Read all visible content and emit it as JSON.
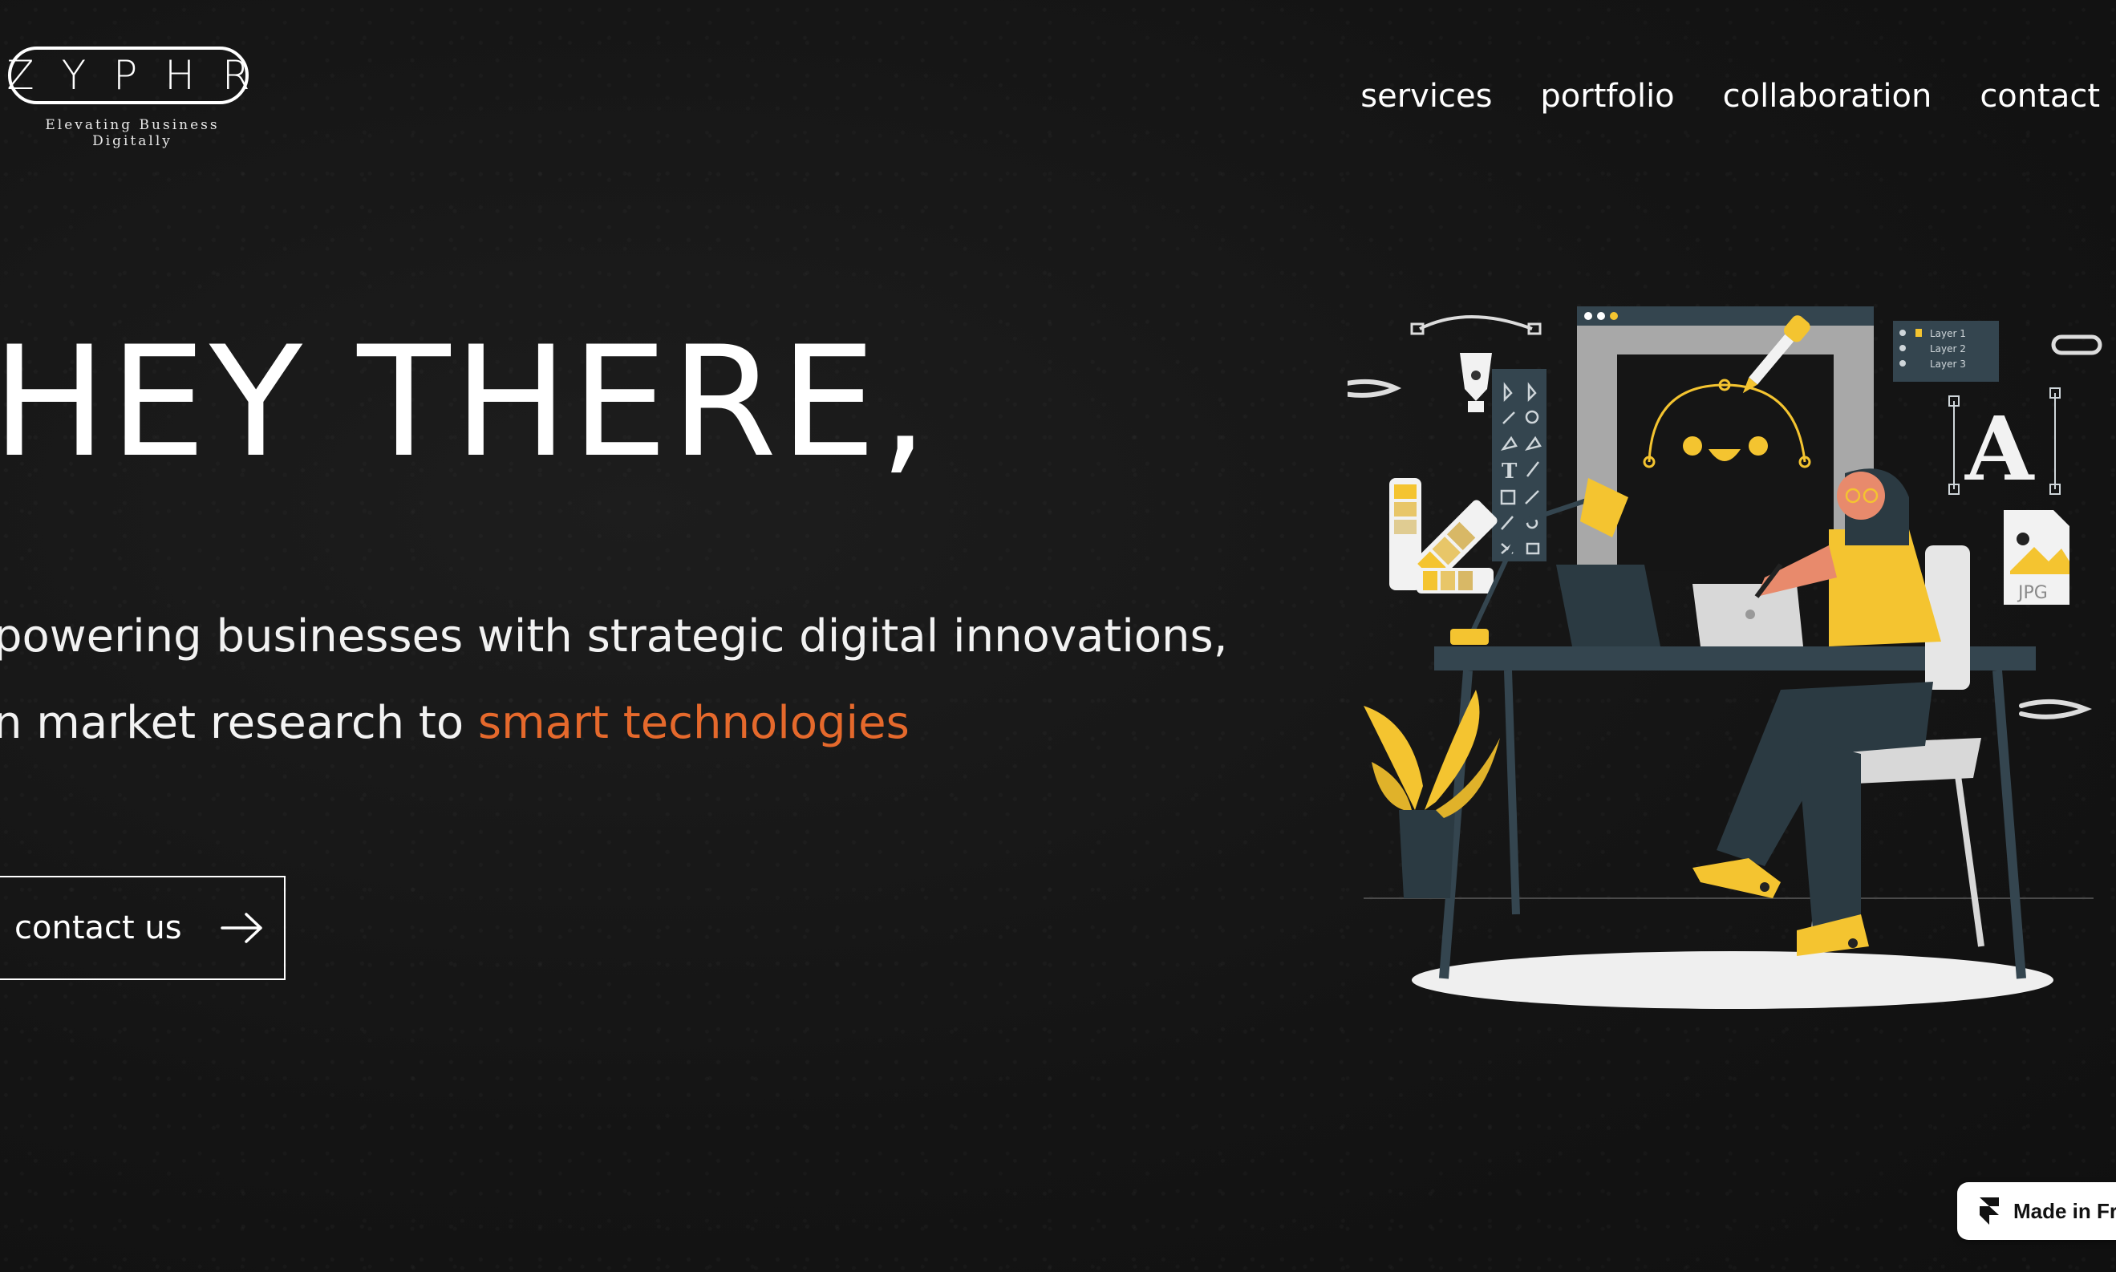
{
  "brand": {
    "logo_text": "ZYPHR",
    "tagline": "Elevating Business Digitally"
  },
  "nav": {
    "items": [
      {
        "label": "services"
      },
      {
        "label": "portfolio"
      },
      {
        "label": "collaboration"
      },
      {
        "label": "contact"
      }
    ]
  },
  "hero": {
    "title": "HEY THERE,",
    "line1": "powering businesses with strategic digital innovations,",
    "line2_prefix": "n market research to ",
    "line2_accent": "smart technologies",
    "cta_label": "contact us"
  },
  "illustration": {
    "layers": [
      "Layer 1",
      "Layer 2",
      "Layer 3"
    ],
    "file_badge": "JPG",
    "font_glyph": "A"
  },
  "badge": {
    "label": "Made in Fra"
  },
  "colors": {
    "accent": "#e5692c",
    "yellow": "#f4c430",
    "dark_slate": "#2b3a42",
    "background": "#151515"
  }
}
